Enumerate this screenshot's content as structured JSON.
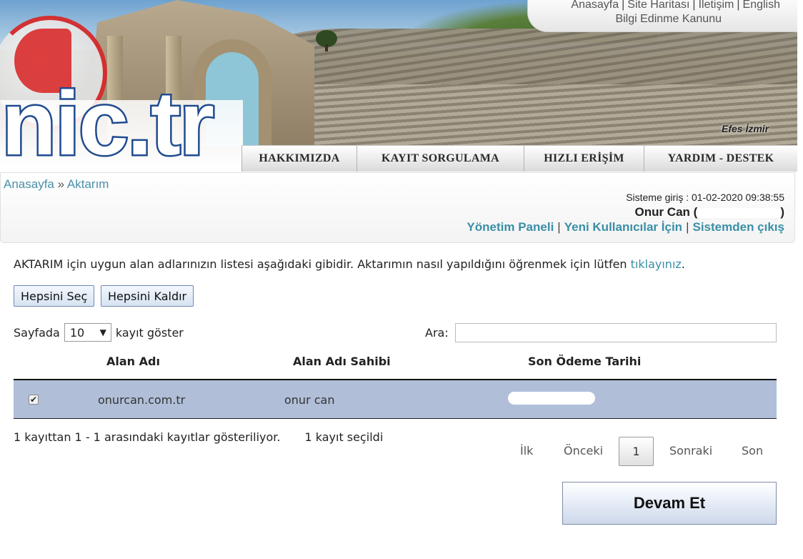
{
  "header": {
    "logo_text": "nic.tr",
    "photo_caption": "Efes İzmir",
    "top_links": [
      "Anasayfa",
      "Site Haritası",
      "İletişim",
      "English"
    ],
    "top_links_second_line": "Bilgi Edinme Kanunu",
    "nav": [
      "HAKKIMIZDA",
      "KAYIT SORGULAMA",
      "HIZLI ERİŞİM",
      "YARDIM - DESTEK"
    ]
  },
  "breadcrumb": {
    "home": "Anasayfa",
    "separator": "»",
    "current": "Aktarım"
  },
  "session": {
    "login_time": "Sisteme giriş : 01-02-2020 09:38:55",
    "user_name": "Onur Can",
    "paren_open": "(",
    "paren_close": ")",
    "links": [
      "Yönetim Paneli",
      "Yeni Kullanıcılar İçin",
      "Sistemden çıkış"
    ]
  },
  "content": {
    "intro_text": "AKTARIM için uygun alan adlarınızın listesi aşağıdaki gibidir. Aktarımın nasıl yapıldığını öğrenmek için lütfen ",
    "intro_link": "tıklayınız",
    "intro_end": ".",
    "select_all": "Hepsini Seç",
    "deselect_all": "Hepsini Kaldır",
    "length_prefix": "Sayfada",
    "length_value": "10",
    "length_suffix": "kayıt göster",
    "search_label": "Ara:",
    "search_value": ""
  },
  "table": {
    "columns": [
      "Alan Adı",
      "Alan Adı Sahibi",
      "Son Ödeme Tarihi"
    ],
    "rows": [
      {
        "checked": true,
        "domain": "onurcan.com.tr",
        "owner": "onur can",
        "due_date": ""
      }
    ]
  },
  "footer": {
    "info": "1 kayıttan 1 - 1 arasındaki kayıtlar gösteriliyor.",
    "selected": "1 kayıt seçildi",
    "pager": {
      "first": "İlk",
      "prev": "Önceki",
      "current": "1",
      "next": "Sonraki",
      "last": "Son"
    },
    "continue_button": "Devam Et"
  },
  "colors": {
    "link": "#3a8fa6",
    "row_selected": "#b0bed8",
    "logo_blue": "#1f4a8f",
    "logo_red": "#d92b2b"
  }
}
